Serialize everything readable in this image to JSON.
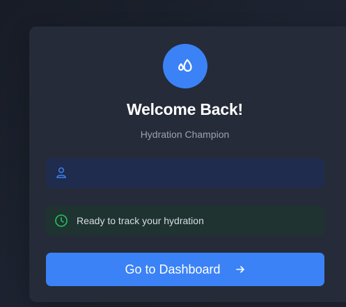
{
  "header": {
    "title": "Welcome Back!",
    "subtitle": "Hydration Champion"
  },
  "form": {
    "name_field": {
      "value": "",
      "placeholder": ""
    }
  },
  "status": {
    "text": "Ready to track your hydration"
  },
  "actions": {
    "primary_label": "Go to Dashboard"
  },
  "icons": {
    "logo": "water-drops-icon",
    "user": "user-icon",
    "status": "clock-icon",
    "arrow": "arrow-right-icon"
  },
  "colors": {
    "accent": "#3b82f6",
    "success": "#22c55e",
    "card": "#252b38"
  }
}
